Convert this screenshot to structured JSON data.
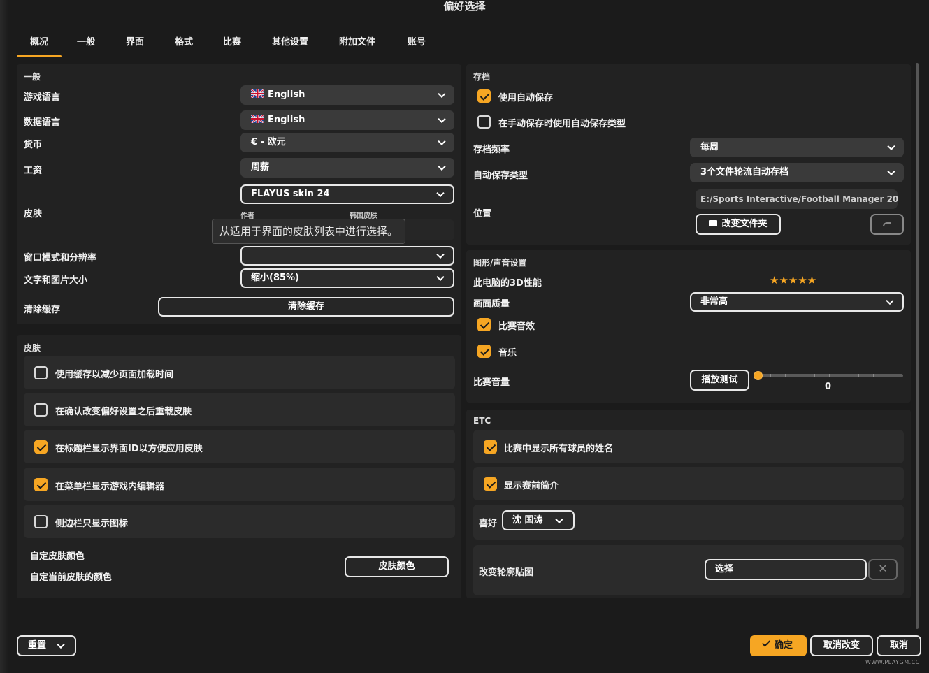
{
  "window": {
    "title": "偏好选择"
  },
  "tabs": [
    "概况",
    "一般",
    "界面",
    "格式",
    "比赛",
    "其他设置",
    "附加文件",
    "账号"
  ],
  "general": {
    "section_label": "一般",
    "game_language": {
      "label": "游戏语言",
      "value": "English"
    },
    "data_language": {
      "label": "数据语言",
      "value": "English"
    },
    "currency": {
      "label": "货币",
      "value": "€ - 欧元"
    },
    "wage": {
      "label": "工资",
      "value": "周薪"
    },
    "skin": {
      "label": "皮肤",
      "value": "FLAYUS skin 24",
      "author_label": "作者",
      "author_value": "韩国皮肤",
      "tooltip": "从适用于界面的皮肤列表中进行选择。"
    },
    "window_mode": {
      "label": "窗口模式和分辨率",
      "value": ""
    },
    "text_size": {
      "label": "文字和图片大小",
      "value": "缩小(85%)"
    },
    "clear_cache": {
      "label": "清除缓存",
      "button": "清除缓存"
    }
  },
  "skin_section": {
    "section_label": "皮肤",
    "options": [
      {
        "label": "使用缓存以减少页面加载时间",
        "checked": false
      },
      {
        "label": "在确认改变偏好设置之后重载皮肤",
        "checked": false
      },
      {
        "label": "在标题栏显示界面ID以方便应用皮肤",
        "checked": true
      },
      {
        "label": "在菜单栏显示游戏内编辑器",
        "checked": true
      },
      {
        "label": "侧边栏只显示图标",
        "checked": false
      }
    ],
    "custom_color_title": "自定皮肤颜色",
    "custom_color_desc": "自定当前皮肤的颜色",
    "color_button": "皮肤颜色"
  },
  "save": {
    "section_label": "存档",
    "use_autosave": {
      "label": "使用自动保存",
      "checked": true
    },
    "manual_autosave_type": {
      "label": "在手动保存时使用自动保存类型",
      "checked": false
    },
    "frequency": {
      "label": "存档频率",
      "value": "每周"
    },
    "autosave_type": {
      "label": "自动保存类型",
      "value": "3个文件轮流自动存档"
    },
    "location": {
      "label": "位置",
      "path": "E:/Sports Interactive/Football Manager 20...",
      "change_folder": "改变文件夹"
    }
  },
  "graphics": {
    "section_label": "图形/声音设置",
    "pc_3d_label": "此电脑的3D性能",
    "pc_3d_stars": "★★★★★",
    "quality": {
      "label": "画面质量",
      "value": "非常高"
    },
    "match_sfx": {
      "label": "比赛音效",
      "checked": true
    },
    "music": {
      "label": "音乐",
      "checked": true
    },
    "volume": {
      "label": "比赛音量",
      "test_button": "播放测试",
      "value": "0",
      "level": 0
    }
  },
  "etc": {
    "section_label": "ETC",
    "show_all_names": {
      "label": "比赛中显示所有球员的姓名",
      "checked": true
    },
    "show_preview": {
      "label": "显示赛前简介",
      "checked": true
    },
    "favorite": {
      "label": "喜好",
      "value": "沈 国涛"
    },
    "silhouette": {
      "label": "改变轮廓贴图",
      "button": "选择"
    }
  },
  "footer": {
    "reset": "重置",
    "confirm": "确定",
    "revert": "取消改变",
    "cancel": "取消",
    "watermark": "WWW.PLAYGM.CC"
  },
  "colors": {
    "accent": "#f6a623",
    "panel": "#222222",
    "card": "#2b2b2b",
    "bg": "#1b1b1b"
  }
}
